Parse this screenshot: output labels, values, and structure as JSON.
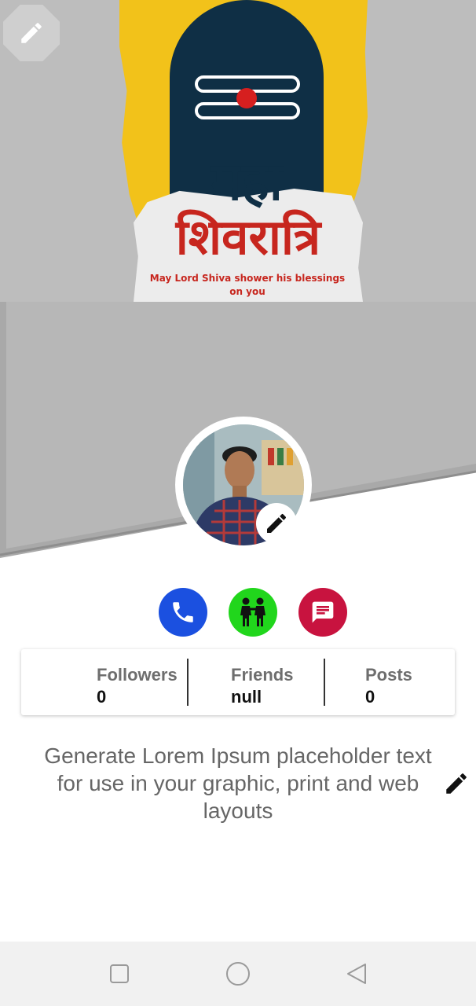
{
  "cover": {
    "banner_title_line1": "महा",
    "banner_title_line2": "शिवरात्रि",
    "banner_caption": "May Lord Shiva shower his blessings on you",
    "colors": {
      "background": "#bdbdbd",
      "yellow": "#f2c21a",
      "navy": "#0f2f45",
      "red": "#c7261e"
    },
    "edit_icon": "pencil-icon"
  },
  "profile": {
    "avatar_edit_icon": "pencil-icon"
  },
  "actions": [
    {
      "name": "call",
      "icon": "phone-icon",
      "color": "#1b50e0"
    },
    {
      "name": "friends",
      "icon": "people-icon",
      "color": "#21d61c"
    },
    {
      "name": "message",
      "icon": "chat-icon",
      "color": "#c8133f"
    }
  ],
  "stats": {
    "followers": {
      "label": "Followers",
      "value": "0"
    },
    "friends": {
      "label": "Friends",
      "value": "null"
    },
    "posts": {
      "label": "Posts",
      "value": "0"
    }
  },
  "bio": {
    "text": "Generate Lorem Ipsum placeholder text for use in your graphic, print and web layouts",
    "edit_icon": "pencil-icon"
  },
  "navbar": {
    "icons": [
      "recents-square-icon",
      "home-circle-icon",
      "back-triangle-icon"
    ]
  }
}
